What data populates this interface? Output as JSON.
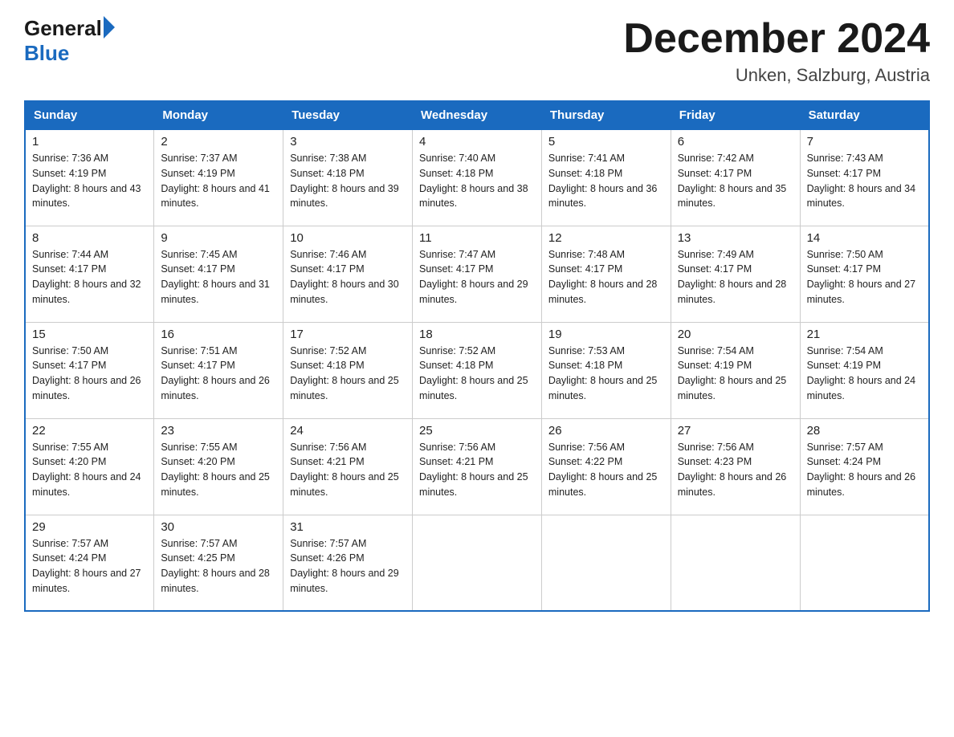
{
  "header": {
    "logo_general": "General",
    "logo_blue": "Blue",
    "month_title": "December 2024",
    "location": "Unken, Salzburg, Austria"
  },
  "days_of_week": [
    "Sunday",
    "Monday",
    "Tuesday",
    "Wednesday",
    "Thursday",
    "Friday",
    "Saturday"
  ],
  "weeks": [
    [
      {
        "day": "1",
        "sunrise": "7:36 AM",
        "sunset": "4:19 PM",
        "daylight": "8 hours and 43 minutes."
      },
      {
        "day": "2",
        "sunrise": "7:37 AM",
        "sunset": "4:19 PM",
        "daylight": "8 hours and 41 minutes."
      },
      {
        "day": "3",
        "sunrise": "7:38 AM",
        "sunset": "4:18 PM",
        "daylight": "8 hours and 39 minutes."
      },
      {
        "day": "4",
        "sunrise": "7:40 AM",
        "sunset": "4:18 PM",
        "daylight": "8 hours and 38 minutes."
      },
      {
        "day": "5",
        "sunrise": "7:41 AM",
        "sunset": "4:18 PM",
        "daylight": "8 hours and 36 minutes."
      },
      {
        "day": "6",
        "sunrise": "7:42 AM",
        "sunset": "4:17 PM",
        "daylight": "8 hours and 35 minutes."
      },
      {
        "day": "7",
        "sunrise": "7:43 AM",
        "sunset": "4:17 PM",
        "daylight": "8 hours and 34 minutes."
      }
    ],
    [
      {
        "day": "8",
        "sunrise": "7:44 AM",
        "sunset": "4:17 PM",
        "daylight": "8 hours and 32 minutes."
      },
      {
        "day": "9",
        "sunrise": "7:45 AM",
        "sunset": "4:17 PM",
        "daylight": "8 hours and 31 minutes."
      },
      {
        "day": "10",
        "sunrise": "7:46 AM",
        "sunset": "4:17 PM",
        "daylight": "8 hours and 30 minutes."
      },
      {
        "day": "11",
        "sunrise": "7:47 AM",
        "sunset": "4:17 PM",
        "daylight": "8 hours and 29 minutes."
      },
      {
        "day": "12",
        "sunrise": "7:48 AM",
        "sunset": "4:17 PM",
        "daylight": "8 hours and 28 minutes."
      },
      {
        "day": "13",
        "sunrise": "7:49 AM",
        "sunset": "4:17 PM",
        "daylight": "8 hours and 28 minutes."
      },
      {
        "day": "14",
        "sunrise": "7:50 AM",
        "sunset": "4:17 PM",
        "daylight": "8 hours and 27 minutes."
      }
    ],
    [
      {
        "day": "15",
        "sunrise": "7:50 AM",
        "sunset": "4:17 PM",
        "daylight": "8 hours and 26 minutes."
      },
      {
        "day": "16",
        "sunrise": "7:51 AM",
        "sunset": "4:17 PM",
        "daylight": "8 hours and 26 minutes."
      },
      {
        "day": "17",
        "sunrise": "7:52 AM",
        "sunset": "4:18 PM",
        "daylight": "8 hours and 25 minutes."
      },
      {
        "day": "18",
        "sunrise": "7:52 AM",
        "sunset": "4:18 PM",
        "daylight": "8 hours and 25 minutes."
      },
      {
        "day": "19",
        "sunrise": "7:53 AM",
        "sunset": "4:18 PM",
        "daylight": "8 hours and 25 minutes."
      },
      {
        "day": "20",
        "sunrise": "7:54 AM",
        "sunset": "4:19 PM",
        "daylight": "8 hours and 25 minutes."
      },
      {
        "day": "21",
        "sunrise": "7:54 AM",
        "sunset": "4:19 PM",
        "daylight": "8 hours and 24 minutes."
      }
    ],
    [
      {
        "day": "22",
        "sunrise": "7:55 AM",
        "sunset": "4:20 PM",
        "daylight": "8 hours and 24 minutes."
      },
      {
        "day": "23",
        "sunrise": "7:55 AM",
        "sunset": "4:20 PM",
        "daylight": "8 hours and 25 minutes."
      },
      {
        "day": "24",
        "sunrise": "7:56 AM",
        "sunset": "4:21 PM",
        "daylight": "8 hours and 25 minutes."
      },
      {
        "day": "25",
        "sunrise": "7:56 AM",
        "sunset": "4:21 PM",
        "daylight": "8 hours and 25 minutes."
      },
      {
        "day": "26",
        "sunrise": "7:56 AM",
        "sunset": "4:22 PM",
        "daylight": "8 hours and 25 minutes."
      },
      {
        "day": "27",
        "sunrise": "7:56 AM",
        "sunset": "4:23 PM",
        "daylight": "8 hours and 26 minutes."
      },
      {
        "day": "28",
        "sunrise": "7:57 AM",
        "sunset": "4:24 PM",
        "daylight": "8 hours and 26 minutes."
      }
    ],
    [
      {
        "day": "29",
        "sunrise": "7:57 AM",
        "sunset": "4:24 PM",
        "daylight": "8 hours and 27 minutes."
      },
      {
        "day": "30",
        "sunrise": "7:57 AM",
        "sunset": "4:25 PM",
        "daylight": "8 hours and 28 minutes."
      },
      {
        "day": "31",
        "sunrise": "7:57 AM",
        "sunset": "4:26 PM",
        "daylight": "8 hours and 29 minutes."
      },
      null,
      null,
      null,
      null
    ]
  ]
}
